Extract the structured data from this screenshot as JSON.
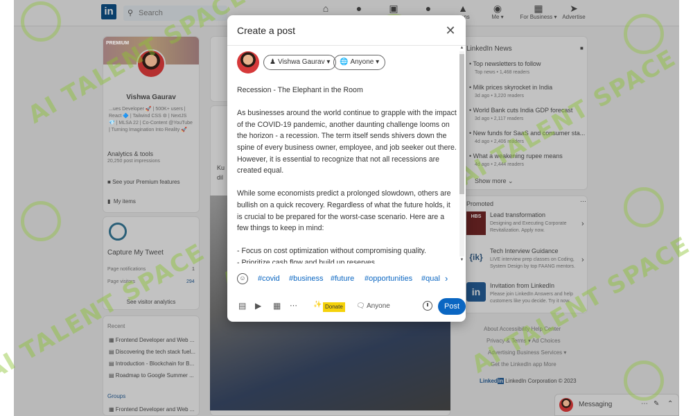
{
  "nav": {
    "search_placeholder": "Search",
    "items": [
      {
        "label": "",
        "icon": "home-icon"
      },
      {
        "label": "",
        "icon": "network-icon"
      },
      {
        "label": "",
        "icon": "jobs-icon"
      },
      {
        "label": "",
        "icon": "messaging-icon"
      },
      {
        "label": "...ons",
        "icon": "notifications-icon"
      },
      {
        "label": "Me",
        "icon": "avatar-icon"
      },
      {
        "label": "For Business",
        "icon": "grid-icon"
      },
      {
        "label": "Advertise",
        "icon": "advertise-icon"
      }
    ]
  },
  "profile": {
    "badge": "PREMIUM",
    "name": "Vishwa Gaurav",
    "headline": [
      "...ues Developer 🚀 | 500K+ users |",
      "React 🔷 | Tailwind CSS ⚙ | NextJS",
      "💎 | MLSA 22 | Co-Content @YouTube",
      "| Turning Imagination Into Reality 🚀"
    ],
    "analytics_title": "Analytics & tools",
    "analytics_sub": "20,250 post impressions",
    "premium_link": "See your Premium features",
    "my_items": "My items"
  },
  "page_card": {
    "title": "Capture My Tweet",
    "row1_label": "Page notifications",
    "row1_value": "1",
    "row2_label": "Page visitors",
    "row2_value": "294",
    "link": "See visitor analytics"
  },
  "recent": {
    "title": "Recent",
    "items": [
      "Frontend Developer and Web ...",
      "Discovering the tech stack fuel...",
      "Introduction - Blockchain for B...",
      "Roadmap to Google Summer ..."
    ],
    "groups_title": "Groups",
    "group_item": "Frontend Developer and Web ..."
  },
  "feed": {
    "snippet_1": "Ku",
    "snippet_2": "dil"
  },
  "news": {
    "title": "LinkedIn News",
    "items": [
      {
        "headline": "Top newsletters to follow",
        "meta": "Top news • 1,468 readers"
      },
      {
        "headline": "Milk prices skyrocket in India",
        "meta": "3d ago • 3,220 readers"
      },
      {
        "headline": "World Bank cuts India GDP forecast",
        "meta": "3d ago • 2,117 readers"
      },
      {
        "headline": "New funds for SaaS and consumer sta...",
        "meta": "4d ago • 2,406 readers"
      },
      {
        "headline": "What a weakening rupee means",
        "meta": "4d ago • 2,444 readers"
      }
    ],
    "show_more": "Show more"
  },
  "promoted": {
    "title": "Promoted",
    "items": [
      {
        "logo": "HBS",
        "title": "Lead transformation",
        "desc": [
          "Designing and Executing Corporate",
          "Revitalization. Apply now."
        ]
      },
      {
        "logo": "{ik}",
        "title": "Tech Interview Guidance",
        "desc": [
          "LIVE interview prep classes on Coding,",
          "System Design by top FAANG mentors."
        ]
      },
      {
        "logo": "in",
        "title": "Invitation from LinkedIn",
        "desc": [
          "Please join LinkedIn Answers and help",
          "customers like you decide. Try it now."
        ]
      }
    ]
  },
  "footer": {
    "line1": "About   Accessibility   Help Center",
    "line2": "Privacy & Terms ▾   Ad Choices",
    "line3": "Advertising   Business Services ▾",
    "line4": "Get the LinkedIn app   More",
    "copyright": "LinkedIn Corporation © 2023"
  },
  "messaging": {
    "label": "Messaging"
  },
  "modal": {
    "title": "Create a post",
    "author_name": "Vishwa Gaurav",
    "visibility": "Anyone",
    "content": [
      "Recession - The Elephant in the Room",
      "As businesses around the world continue to grapple with the impact of the COVID-19 pandemic, another daunting challenge looms on the horizon - a recession. The term itself sends shivers down the spine of every business owner, employee, and job seeker out there. However, it is essential to recognize that not all recessions are created equal.",
      "While some economists predict a prolonged slowdown, others are bullish on a quick recovery. Regardless of what the future holds, it is crucial to be prepared for the worst-case scenario. Here are a few things to keep in mind:",
      "- Focus on cost optimization without compromising quality.",
      "- Prioritize cash flow and build up reserves."
    ],
    "hashtags": [
      "#covid",
      "#business",
      "#future",
      "#opportunities",
      "#qual"
    ],
    "donate_label": "Donate",
    "comment_visibility": "Anyone",
    "post_button": "Post"
  },
  "watermark": {
    "text": "AI TALENT SPACE",
    "color": "#8cc332"
  },
  "colors": {
    "accent": "#0a66c2",
    "donate": "#f5d20a"
  }
}
